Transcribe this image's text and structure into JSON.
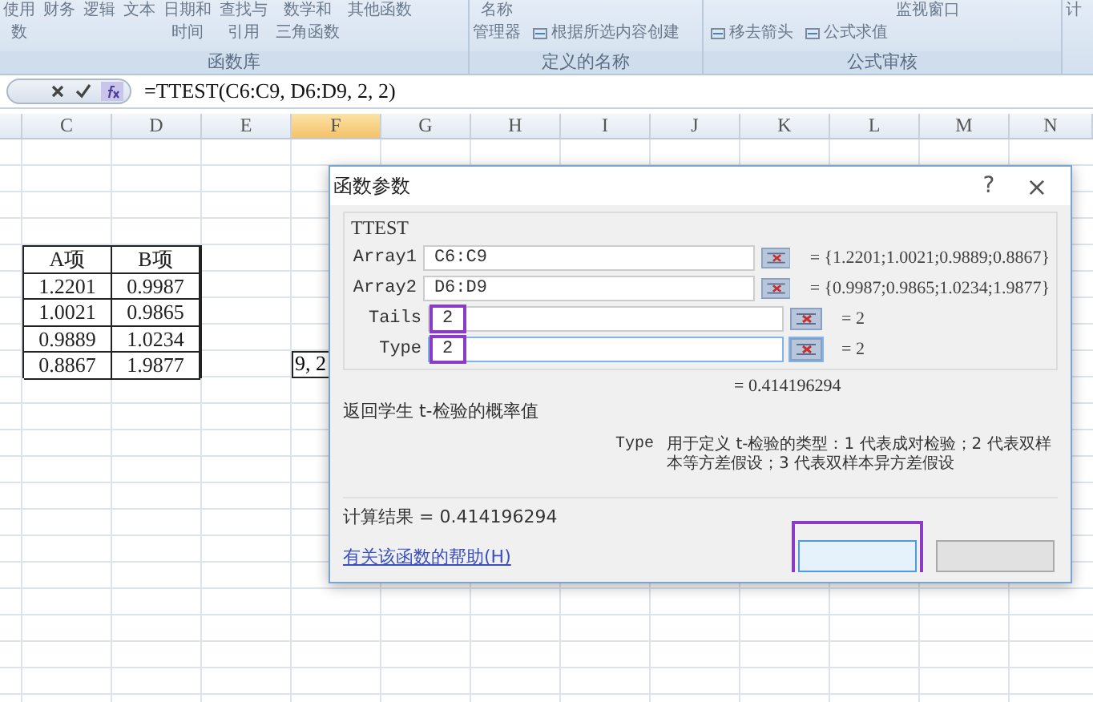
{
  "ribbon": {
    "groups": [
      {
        "label": "函数库",
        "buttons": [
          {
            "kind": "large",
            "lines": [
              "使用",
              "数"
            ]
          },
          {
            "kind": "large",
            "lines": [
              "财务"
            ]
          },
          {
            "kind": "large",
            "lines": [
              "逻辑"
            ]
          },
          {
            "kind": "large",
            "lines": [
              "文本"
            ]
          },
          {
            "kind": "large",
            "lines": [
              "日期和",
              "时间"
            ]
          },
          {
            "kind": "large",
            "lines": [
              "查找与",
              "引用"
            ]
          },
          {
            "kind": "large",
            "lines": [
              "数学和",
              "三角函数"
            ]
          },
          {
            "kind": "large",
            "lines": [
              "其他函数"
            ]
          }
        ]
      },
      {
        "label": "定义的名称",
        "buttons": [
          {
            "kind": "large",
            "lines": [
              "名称",
              "管理器"
            ]
          },
          {
            "kind": "small",
            "lines": [
              "根据所选内容创建"
            ]
          }
        ]
      },
      {
        "label": "公式审核",
        "buttons": [
          {
            "kind": "small",
            "lines": [
              "移去箭头"
            ]
          },
          {
            "kind": "small",
            "lines": [
              "公式求值"
            ]
          },
          {
            "kind": "large",
            "lines": [
              "监视窗口"
            ]
          }
        ]
      },
      {
        "buttons": [
          {
            "kind": "large",
            "lines": [
              "计"
            ]
          }
        ]
      }
    ]
  },
  "formula_bar": {
    "formula": "=TTEST(C6:C9, D6:D9, 2, 2)"
  },
  "columns": [
    {
      "label": "C",
      "selected": false
    },
    {
      "label": "D",
      "selected": false
    },
    {
      "label": "E",
      "selected": false
    },
    {
      "label": "F",
      "selected": true
    },
    {
      "label": "G",
      "selected": false
    },
    {
      "label": "H",
      "selected": false
    },
    {
      "label": "I",
      "selected": false
    },
    {
      "label": "J",
      "selected": false
    },
    {
      "label": "K",
      "selected": false
    },
    {
      "label": "L",
      "selected": false
    },
    {
      "label": "M",
      "selected": false
    },
    {
      "label": "N",
      "selected": false
    }
  ],
  "data_table": {
    "rows": [
      [
        "A项",
        "B项"
      ],
      [
        "1.2201",
        "0.9987"
      ],
      [
        "1.0021",
        "0.9865"
      ],
      [
        "0.9889",
        "1.0234"
      ],
      [
        "0.8867",
        "1.9877"
      ]
    ]
  },
  "editing_cell": {
    "text": "9, 2"
  },
  "dialog": {
    "title": "函数参数",
    "help": "?",
    "close": "×",
    "function_name": "TTEST",
    "arguments": [
      {
        "label": "Array1",
        "value": "C6:C9",
        "result": "= {1.2201;1.0021;0.9889;0.8867}",
        "highlighted": false,
        "focused": false
      },
      {
        "label": "Array2",
        "value": "D6:D9",
        "result": "= {0.9987;0.9865;1.0234;1.9877}",
        "highlighted": false,
        "focused": false
      },
      {
        "label": "Tails",
        "value": "2",
        "result": "= 2",
        "highlighted": true,
        "focused": false
      },
      {
        "label": "Type",
        "value": "2",
        "result": "= 2",
        "highlighted": true,
        "focused": true
      }
    ],
    "formula_result": "= 0.414196294",
    "description": "返回学生 t-检验的概率值",
    "param_name": "Type",
    "param_description": "用于定义 t-检验的类型：1 代表成对检验；2 代表双样本等方差假设；3 代表双样本异方差假设",
    "calc_result": "计算结果 =  0.414196294",
    "help_link": "有关该函数的帮助(H)",
    "buttons": [
      {
        "highlighted": true
      },
      {
        "highlighted": false
      }
    ]
  }
}
